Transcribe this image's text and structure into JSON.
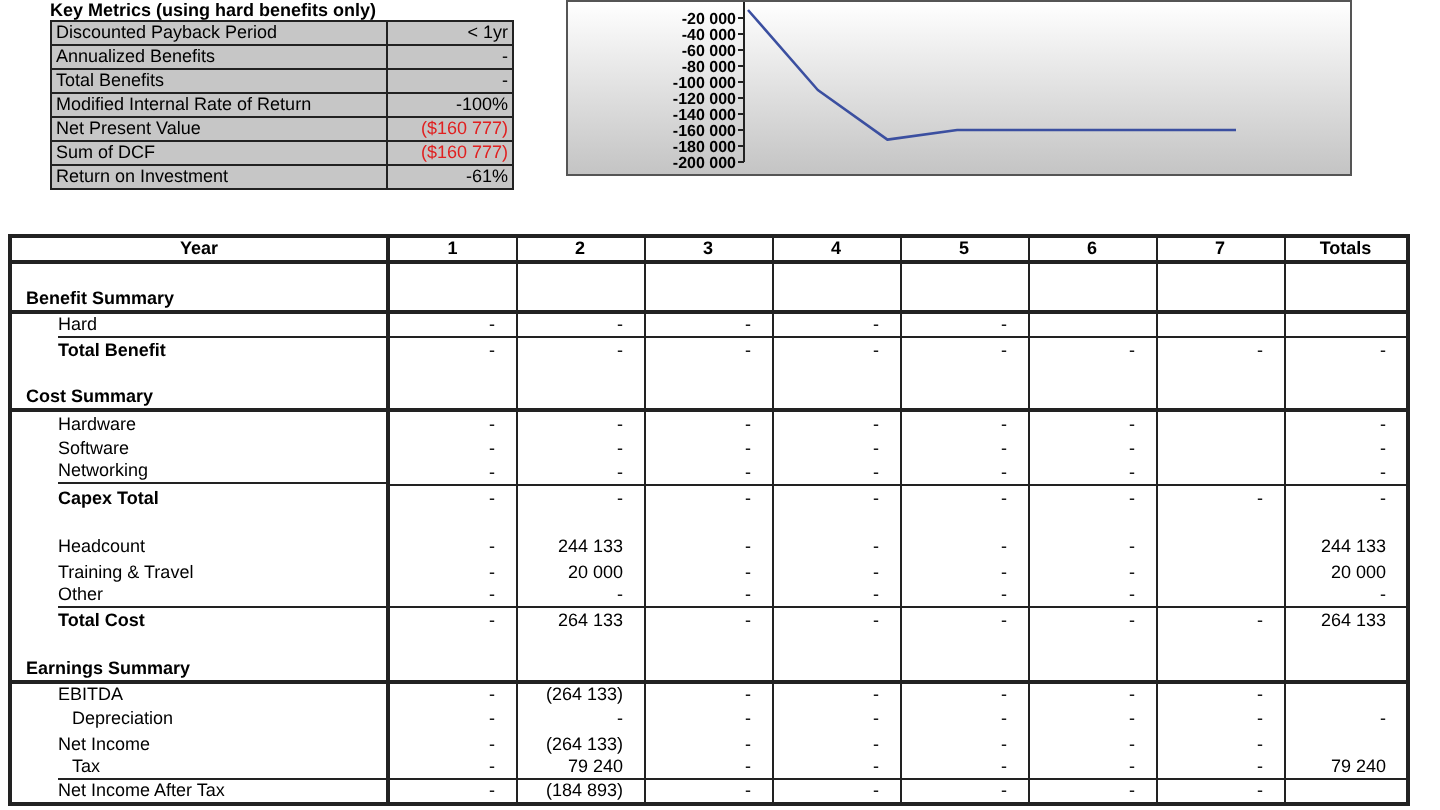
{
  "key_metrics": {
    "title": "Key Metrics (using hard benefits only)",
    "rows": [
      {
        "label": "Discounted Payback Period",
        "value": "< 1yr",
        "negative": false
      },
      {
        "label": "Annualized Benefits",
        "value": "-",
        "negative": false
      },
      {
        "label": "Total Benefits",
        "value": "-",
        "negative": false
      },
      {
        "label": "Modified Internal Rate of Return",
        "value": "-100%",
        "negative": false
      },
      {
        "label": "Net Present Value",
        "value": "($160 777)",
        "negative": true
      },
      {
        "label": "Sum of DCF",
        "value": "($160 777)",
        "negative": true
      },
      {
        "label": "Return on Investment",
        "value": "-61%",
        "negative": false
      }
    ]
  },
  "chart": {
    "chart_data": {
      "type": "line",
      "ylim": [
        -200000,
        0
      ],
      "yticks": [
        {
          "value": -20000,
          "label": "-20 000"
        },
        {
          "value": -40000,
          "label": "-40 000"
        },
        {
          "value": -60000,
          "label": "-60 000"
        },
        {
          "value": -80000,
          "label": "-80 000"
        },
        {
          "value": -100000,
          "label": "-100 000"
        },
        {
          "value": -120000,
          "label": "-120 000"
        },
        {
          "value": -140000,
          "label": "-140 000"
        },
        {
          "value": -160000,
          "label": "-160 000"
        },
        {
          "value": -180000,
          "label": "-180 000"
        },
        {
          "value": -200000,
          "label": "-200 000"
        }
      ],
      "series": [
        {
          "color": "#3b4fa0",
          "values": [
            -10000,
            -110000,
            -172000,
            -160000,
            -160000,
            -160000,
            -160000,
            -160000
          ]
        }
      ]
    }
  },
  "table": {
    "year_header": "Year",
    "columns": [
      "1",
      "2",
      "3",
      "4",
      "5",
      "6",
      "7",
      "Totals"
    ],
    "rows": [
      {
        "kind": "blank",
        "label": null,
        "cells": []
      },
      {
        "kind": "section",
        "label": "Benefit Summary",
        "cells": []
      },
      {
        "kind": "item",
        "label": "Hard",
        "cells": [
          "-",
          "-",
          "-",
          "-",
          "-",
          null,
          null,
          null
        ]
      },
      {
        "kind": "total",
        "label": "Total Benefit",
        "cells": [
          "-",
          "-",
          "-",
          "-",
          "-",
          "-",
          "-",
          "-"
        ]
      },
      {
        "kind": "blank",
        "label": null,
        "cells": []
      },
      {
        "kind": "section",
        "label": "Cost Summary",
        "cells": []
      },
      {
        "kind": "item",
        "label": "Hardware",
        "cells": [
          "-",
          "-",
          "-",
          "-",
          "-",
          "-",
          null,
          "-"
        ]
      },
      {
        "kind": "item",
        "label": "Software",
        "cells": [
          "-",
          "-",
          "-",
          "-",
          "-",
          "-",
          null,
          "-"
        ]
      },
      {
        "kind": "item",
        "label": "Networking",
        "cells": [
          "-",
          "-",
          "-",
          "-",
          "-",
          "-",
          null,
          "-"
        ]
      },
      {
        "kind": "total",
        "label": "Capex Total",
        "cells": [
          "-",
          "-",
          "-",
          "-",
          "-",
          "-",
          "-",
          "-"
        ]
      },
      {
        "kind": "blank",
        "label": null,
        "cells": []
      },
      {
        "kind": "item",
        "label": "Headcount",
        "cells": [
          "-",
          "244 133",
          "-",
          "-",
          "-",
          "-",
          null,
          "244 133"
        ]
      },
      {
        "kind": "item",
        "label": "Training & Travel",
        "cells": [
          "-",
          "20 000",
          "-",
          "-",
          "-",
          "-",
          null,
          "20 000"
        ]
      },
      {
        "kind": "item",
        "label": "Other",
        "cells": [
          "-",
          "-",
          "-",
          "-",
          "-",
          "-",
          null,
          "-"
        ]
      },
      {
        "kind": "total",
        "label": "Total Cost",
        "cells": [
          "-",
          "264 133",
          "-",
          "-",
          "-",
          "-",
          "-",
          "264 133"
        ]
      },
      {
        "kind": "blank",
        "label": null,
        "cells": []
      },
      {
        "kind": "section",
        "label": "Earnings Summary",
        "cells": []
      },
      {
        "kind": "item",
        "label": "EBITDA",
        "cells": [
          "-",
          "(264 133)",
          "-",
          "-",
          "-",
          "-",
          "-",
          null
        ]
      },
      {
        "kind": "subitem",
        "label": "Depreciation",
        "cells": [
          "-",
          "-",
          "-",
          "-",
          "-",
          "-",
          "-",
          "-"
        ]
      },
      {
        "kind": "item",
        "label": "Net Income",
        "cells": [
          "-",
          "(264 133)",
          "-",
          "-",
          "-",
          "-",
          "-",
          null
        ]
      },
      {
        "kind": "subitem",
        "label": "Tax",
        "cells": [
          "-",
          "79 240",
          "-",
          "-",
          "-",
          "-",
          "-",
          "79 240"
        ]
      },
      {
        "kind": "plain",
        "label": "Net Income After Tax",
        "cells": [
          "-",
          "(184 893)",
          "-",
          "-",
          "-",
          "-",
          "-",
          null
        ]
      }
    ]
  }
}
